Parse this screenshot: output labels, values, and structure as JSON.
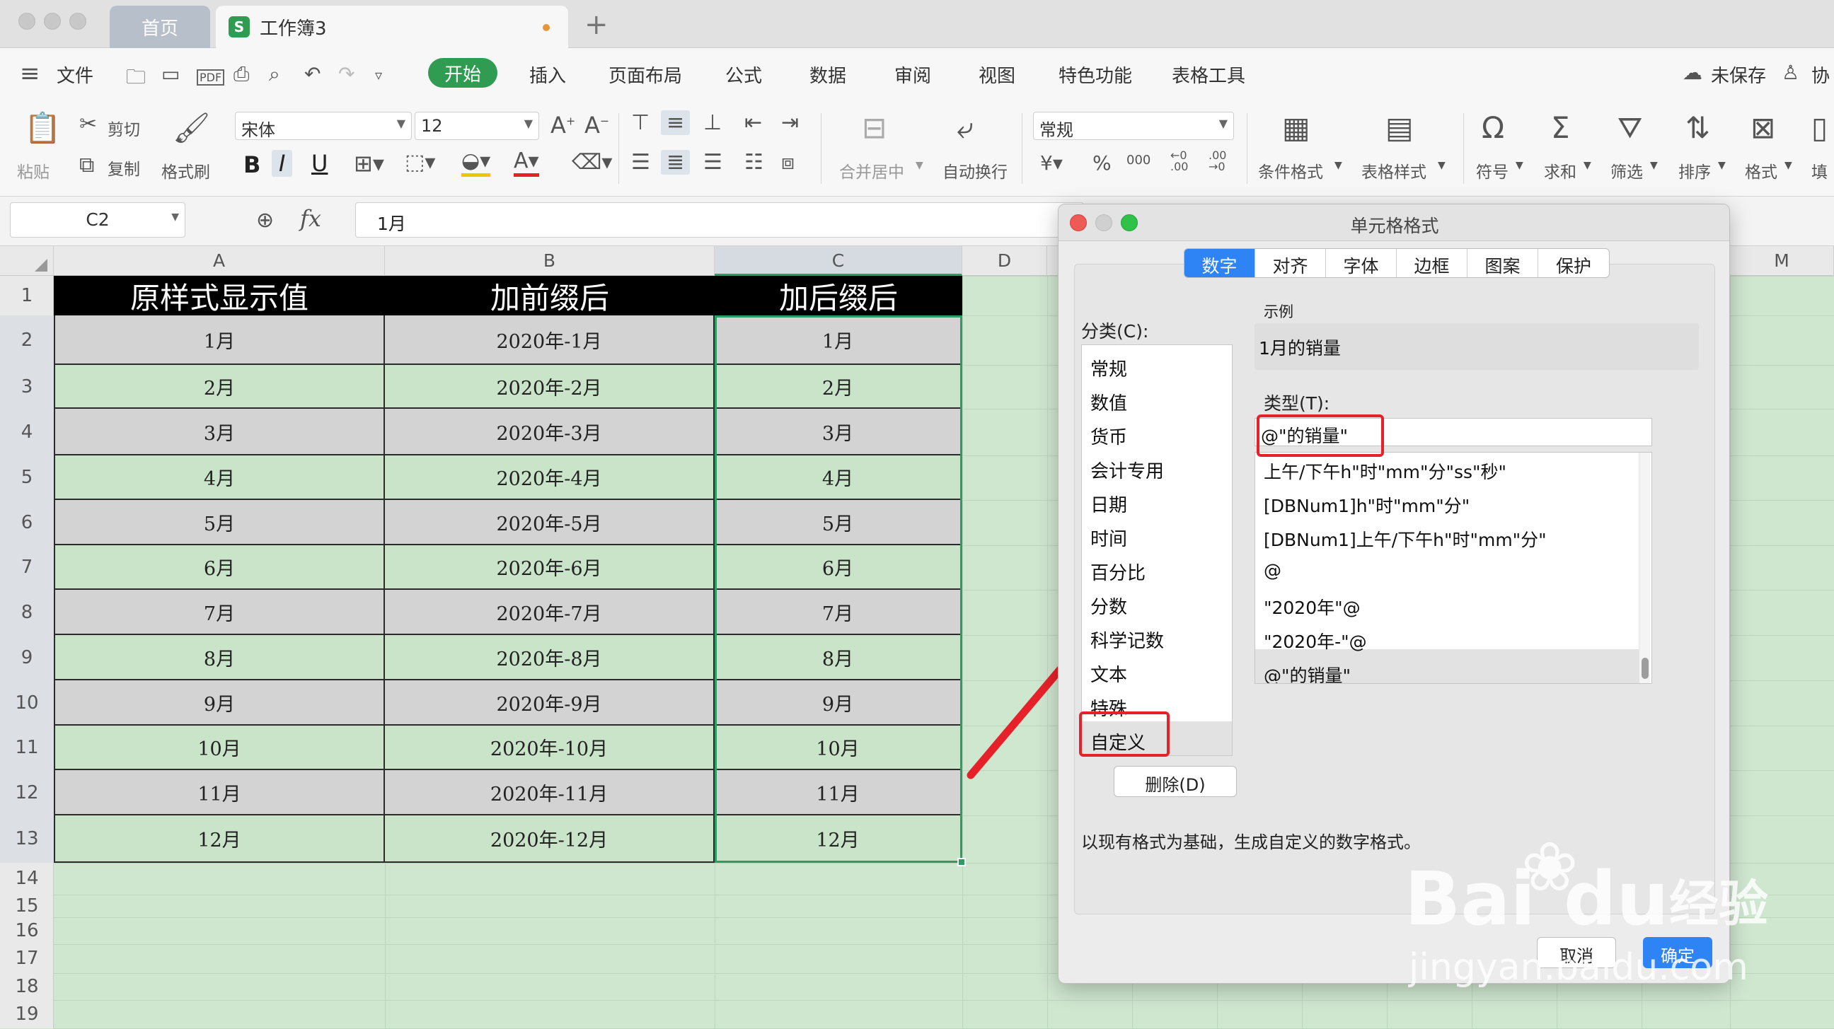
{
  "window": {
    "tabs": [
      {
        "label": "首页"
      },
      {
        "label": "工作簿3"
      }
    ],
    "app_icon_letter": "S",
    "new_tab_symbol": "+"
  },
  "menu": {
    "file": "文件",
    "items": [
      "开始",
      "插入",
      "页面布局",
      "公式",
      "数据",
      "审阅",
      "视图",
      "特色功能",
      "表格工具"
    ],
    "unsaved": "未保存",
    "collab": "协"
  },
  "ribbon": {
    "paste": "粘贴",
    "cut": "剪切",
    "copy": "复制",
    "format_painter": "格式刷",
    "font_name": "宋体",
    "font_size": "12",
    "merge_center": "合并居中",
    "wrap_text": "自动换行",
    "number_format": "常规",
    "conditional_format": "条件格式",
    "table_style": "表格样式",
    "symbol": "符号",
    "sum": "求和",
    "filter": "筛选",
    "sort": "排序",
    "format": "格式",
    "fill": "填"
  },
  "formula_bar": {
    "name_box": "C2",
    "fx": "fx",
    "value": "1月"
  },
  "grid": {
    "columns": [
      "A",
      "B",
      "C",
      "D",
      "M"
    ],
    "row_numbers": [
      "1",
      "2",
      "3",
      "4",
      "5",
      "6",
      "7",
      "8",
      "9",
      "10",
      "11",
      "12",
      "13",
      "14",
      "15",
      "16",
      "17",
      "18",
      "19"
    ],
    "headers": [
      "原样式显示值",
      "加前缀后",
      "加后缀后"
    ],
    "rows": [
      [
        "1月",
        "2020年-1月",
        "1月"
      ],
      [
        "2月",
        "2020年-2月",
        "2月"
      ],
      [
        "3月",
        "2020年-3月",
        "3月"
      ],
      [
        "4月",
        "2020年-4月",
        "4月"
      ],
      [
        "5月",
        "2020年-5月",
        "5月"
      ],
      [
        "6月",
        "2020年-6月",
        "6月"
      ],
      [
        "7月",
        "2020年-7月",
        "7月"
      ],
      [
        "8月",
        "2020年-8月",
        "8月"
      ],
      [
        "9月",
        "2020年-9月",
        "9月"
      ],
      [
        "10月",
        "2020年-10月",
        "10月"
      ],
      [
        "11月",
        "2020年-11月",
        "11月"
      ],
      [
        "12月",
        "2020年-12月",
        "12月"
      ]
    ]
  },
  "dialog": {
    "title": "单元格格式",
    "tabs": [
      "数字",
      "对齐",
      "字体",
      "边框",
      "图案",
      "保护"
    ],
    "category_label": "分类(C):",
    "categories": [
      "常规",
      "数值",
      "货币",
      "会计专用",
      "日期",
      "时间",
      "百分比",
      "分数",
      "科学记数",
      "文本",
      "特殊",
      "自定义"
    ],
    "sample_label": "示例",
    "sample_value": "1月的销量",
    "type_label": "类型(T):",
    "type_value": "@\"的销量\"",
    "formats": [
      "上午/下午h\"时\"mm\"分\"ss\"秒\"",
      "[DBNum1]h\"时\"mm\"分\"",
      "[DBNum1]上午/下午h\"时\"mm\"分\"",
      "@",
      "\"2020年\"@",
      "\"2020年-\"@",
      "@\"的销量\""
    ],
    "delete_button": "删除(D)",
    "description": "以现有格式为基础，生成自定义的数字格式。",
    "cancel_button": "取消",
    "ok_button": "确定"
  },
  "watermark": {
    "brand": "Bai",
    "brand2": "du",
    "cn": "经验",
    "url": "jingyan.baidu.com"
  },
  "colors": {
    "accent_green": "#2f9c52",
    "sheet_green": "#cfe6cf",
    "gray_row": "#d3d3d3",
    "annotation_red": "#e6212a",
    "dialog_blue": "#2f84f5"
  }
}
